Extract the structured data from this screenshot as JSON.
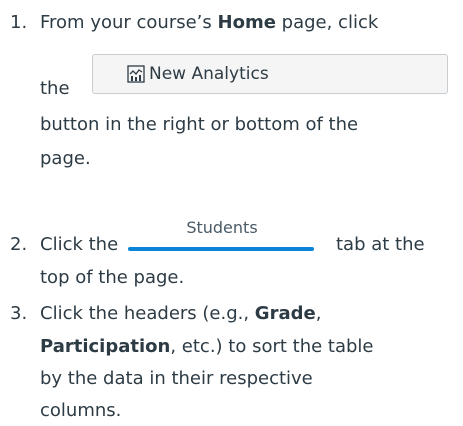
{
  "steps": [
    {
      "number": "1.",
      "text_a": "From your course’s ",
      "bold_a": "Home",
      "text_b": " page, click",
      "text_c": "the",
      "text_d": "button in the right or bottom of the",
      "text_e": "page."
    },
    {
      "number": "2.",
      "text_a": "Click the",
      "text_b": "tab at the",
      "text_c": "top of the page."
    },
    {
      "number": "3.",
      "text_a": "Click the headers (e.g., ",
      "bold_a": "Grade",
      "text_b": ",",
      "bold_b": "Participation",
      "text_c": ", etc.) to sort the table",
      "text_d": "by the data in their respective",
      "text_e": "columns."
    }
  ],
  "new_analytics_button": {
    "label": "New Analytics",
    "icon": "analytics-chart-icon"
  },
  "students_tab": {
    "label": "Students",
    "accent_color": "#0a84d6"
  }
}
